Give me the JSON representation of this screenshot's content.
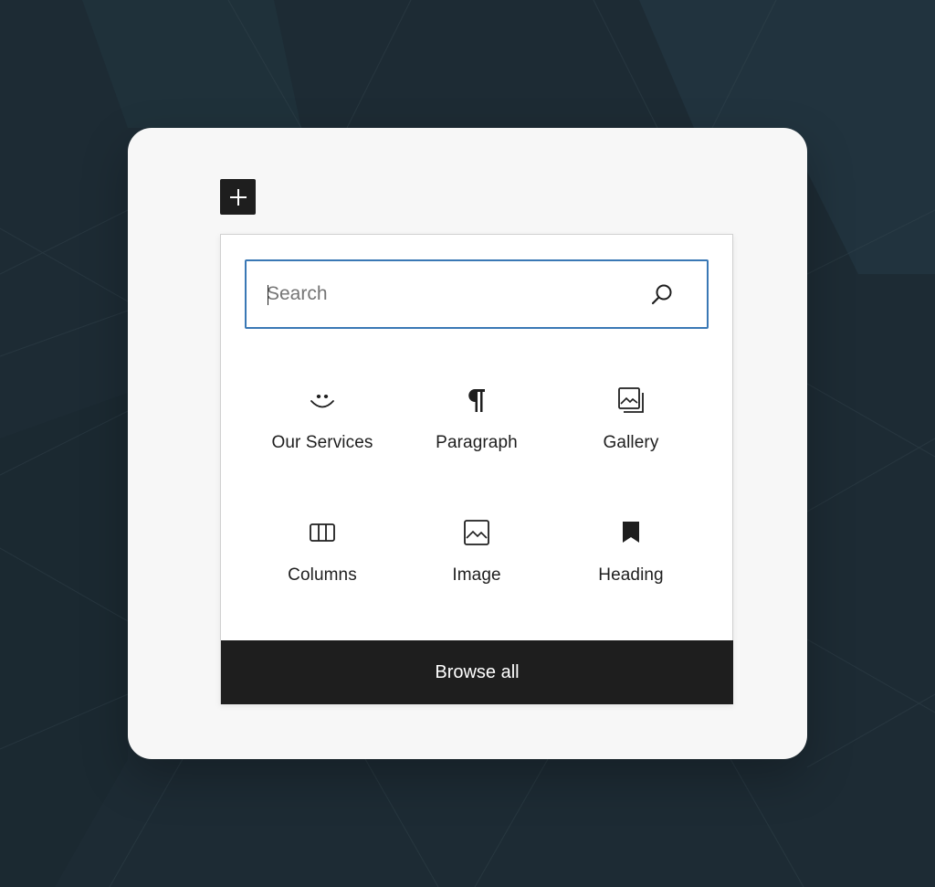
{
  "colors": {
    "background": "#1d2b34",
    "card": "#f7f7f7",
    "accent": "#3a78b5",
    "dark": "#1e1e1e"
  },
  "toolbar": {
    "add_icon": "plus-icon"
  },
  "search": {
    "placeholder": "Search",
    "value": "",
    "icon": "search-icon"
  },
  "blocks": [
    {
      "label": "Our Services",
      "icon": "smiley-icon"
    },
    {
      "label": "Paragraph",
      "icon": "pilcrow-icon"
    },
    {
      "label": "Gallery",
      "icon": "gallery-icon"
    },
    {
      "label": "Columns",
      "icon": "columns-icon"
    },
    {
      "label": "Image",
      "icon": "image-icon"
    },
    {
      "label": "Heading",
      "icon": "bookmark-icon"
    }
  ],
  "footer": {
    "browse_all_label": "Browse all"
  }
}
